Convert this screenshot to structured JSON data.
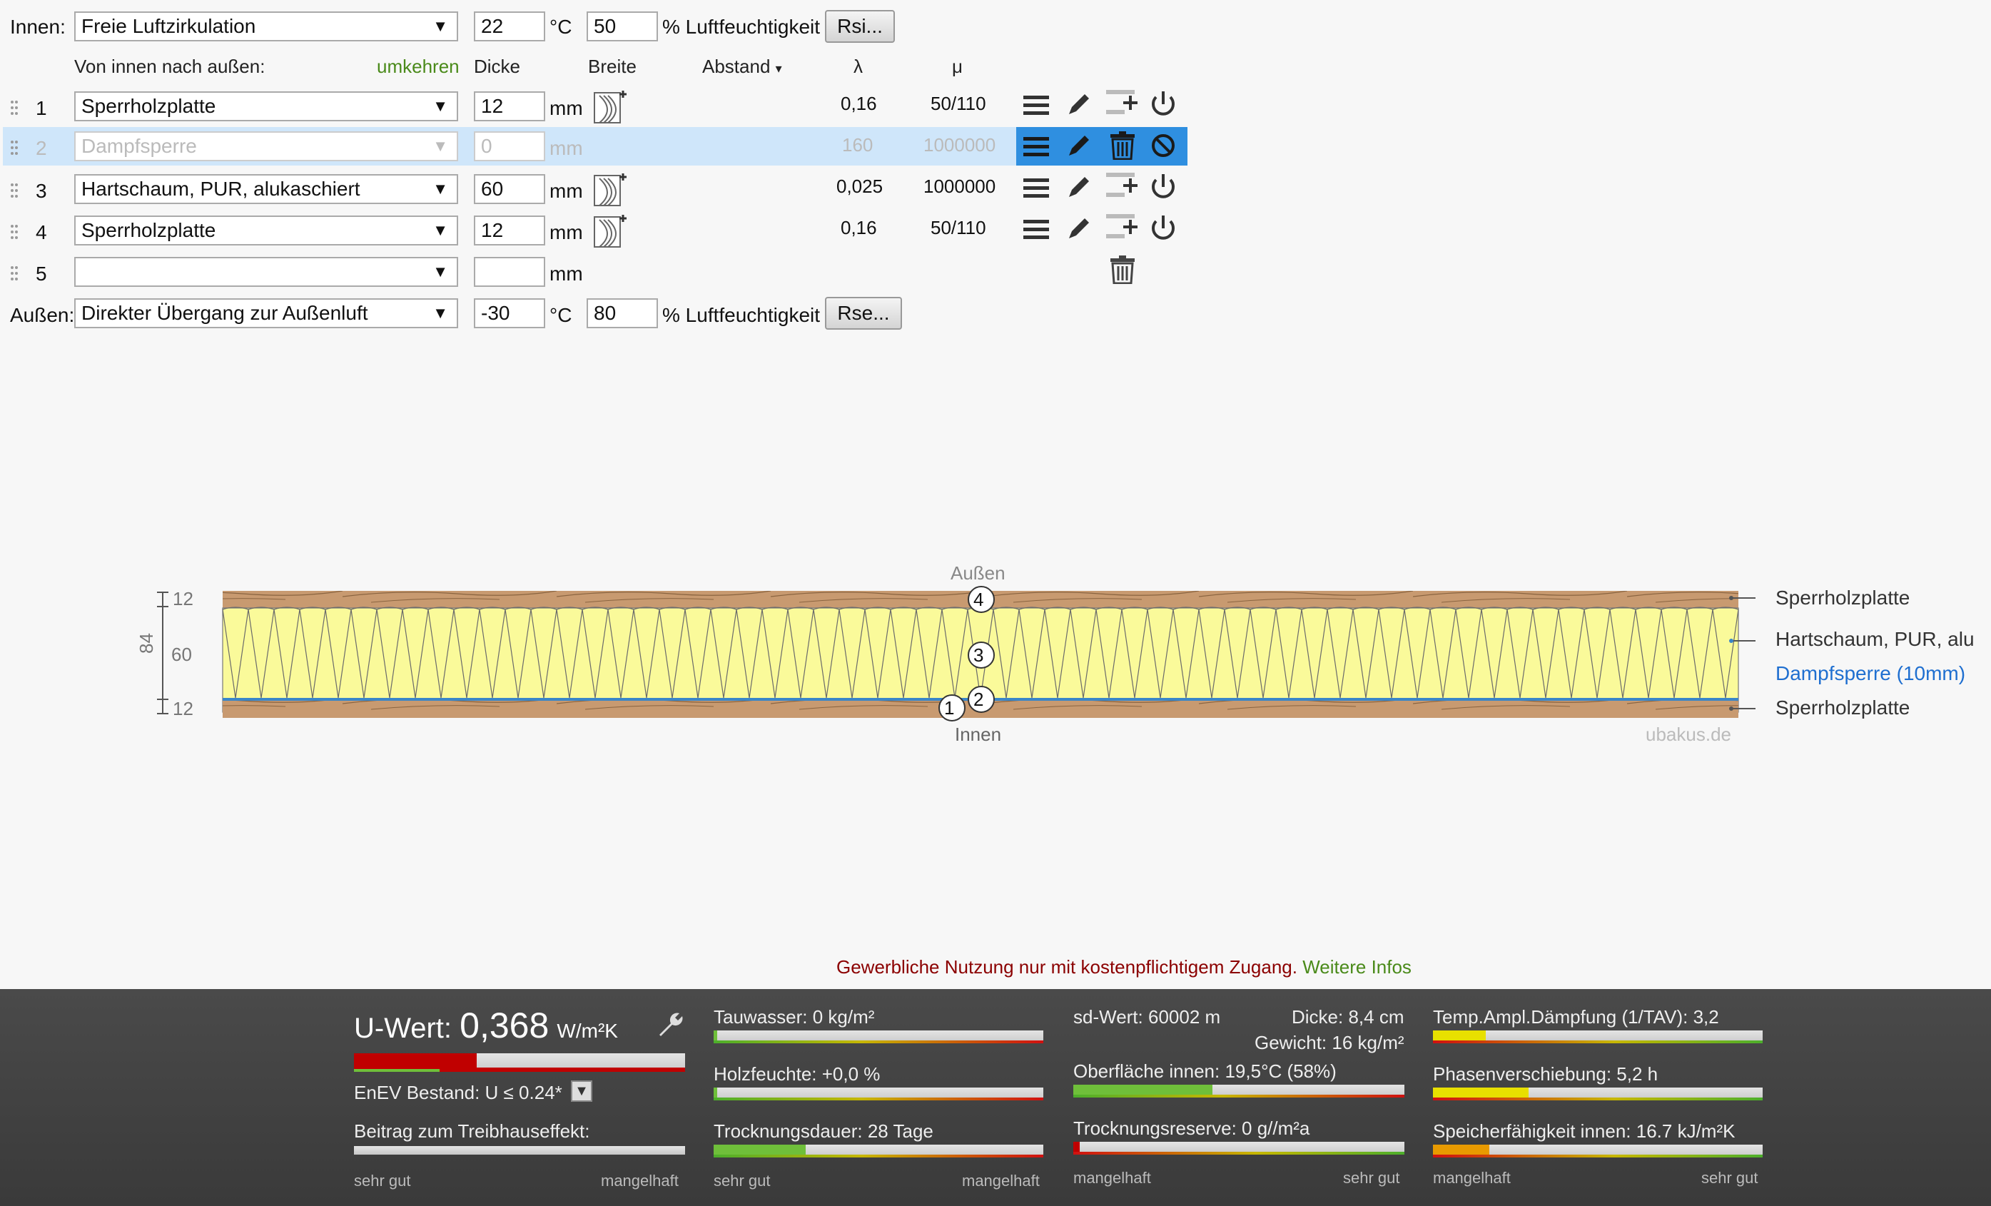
{
  "top": {
    "innen_label": "Innen:",
    "innen_select": "Freie Luftzirkulation",
    "innen_temp": "22",
    "temp_unit": "°C",
    "innen_humidity": "50",
    "humidity_label": "% Luftfeuchtigkeit",
    "rsi_button": "Rsi..."
  },
  "header": {
    "direction": "Von innen nach außen:",
    "reverse": "umkehren",
    "dicke": "Dicke",
    "breite": "Breite",
    "abstand": "Abstand",
    "lambda": "λ",
    "mu": "μ"
  },
  "layers": [
    {
      "num": "1",
      "material": "Sperrholzplatte",
      "thickness": "12",
      "unit": "mm",
      "lambda": "0,16",
      "mu": "50/110"
    },
    {
      "num": "2",
      "material": "Dampfsperre",
      "thickness": "0",
      "unit": "mm",
      "lambda": "160",
      "mu": "1000000"
    },
    {
      "num": "3",
      "material": "Hartschaum, PUR, alukaschiert",
      "thickness": "60",
      "unit": "mm",
      "lambda": "0,025",
      "mu": "1000000"
    },
    {
      "num": "4",
      "material": "Sperrholzplatte",
      "thickness": "12",
      "unit": "mm",
      "lambda": "0,16",
      "mu": "50/110"
    },
    {
      "num": "5",
      "material": "",
      "thickness": "",
      "unit": "mm",
      "lambda": "",
      "mu": ""
    }
  ],
  "bottom_row": {
    "aussen_label": "Außen:",
    "aussen_select": "Direkter Übergang zur Außenluft",
    "aussen_temp": "-30",
    "temp_unit": "°C",
    "aussen_humidity": "80",
    "humidity_label": "% Luftfeuchtigkeit",
    "rse_button": "Rse..."
  },
  "diagram": {
    "outside": "Außen",
    "inside": "Innen",
    "total": "84",
    "dims": [
      "12",
      "60",
      "12"
    ],
    "markers": [
      "4",
      "3",
      "2",
      "1"
    ],
    "labels": [
      "Sperrholzplatte",
      "Hartschaum, PUR, alu",
      "Dampfsperre (10mm)",
      "Sperrholzplatte"
    ],
    "watermark": "ubakus.de"
  },
  "notice": {
    "text": "Gewerbliche Nutzung nur mit kostenpflichtigem Zugang.",
    "link": "Weitere Infos"
  },
  "results": {
    "u_label": "U-Wert:",
    "u_value": "0,368",
    "u_unit": "W/m²K",
    "u_bar_fraction": 0.37,
    "enev": "EnEV Bestand: U ≤ 0.24*",
    "treibhaus": "Beitrag zum Treibhauseffekt:",
    "sehr_gut": "sehr gut",
    "mangelhaft": "mangelhaft",
    "tauwasser": "Tauwasser: 0 kg/m²",
    "tauwasser_fraction": 0.01,
    "holzfeuchte": "Holzfeuchte: +0,0 %",
    "holzfeuchte_fraction": 0.01,
    "trocknungsdauer": "Trocknungsdauer: 28 Tage",
    "trocknungsdauer_fraction": 0.28,
    "sd_wert": "sd-Wert: 60002 m",
    "dicke": "Dicke: 8,4 cm",
    "gewicht": "Gewicht: 16 kg/m²",
    "oberflaeche": "Oberfläche innen: 19,5°C (58%)",
    "oberflaeche_fraction": 0.42,
    "trocknungsreserve": "Trocknungsreserve: 0 g//m²a",
    "trocknungsreserve_fraction": 0.02,
    "temp_amp": "Temp.Ampl.Dämpfung (1/TAV): 3,2",
    "temp_amp_fraction": 0.16,
    "phasen": "Phasenverschiebung: 5,2 h",
    "phasen_fraction": 0.29,
    "speicher": "Speicherfähigkeit innen: 16.7 kJ/m²K",
    "speicher_fraction": 0.17,
    "colors": {
      "red": "#c00000",
      "green": "#6fbf3a",
      "yellow": "#e8e000",
      "orange": "#e89a00"
    }
  }
}
